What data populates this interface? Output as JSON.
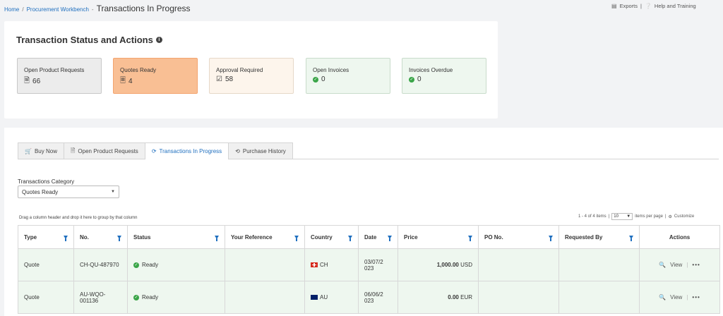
{
  "breadcrumb": {
    "home": "Home",
    "separator": "/",
    "workbench": "Procurement Workbench",
    "dash": "-",
    "current": "Transactions In Progress"
  },
  "top_links": {
    "exports": "Exports",
    "divider": "|",
    "help": "Help and Training"
  },
  "status_panel": {
    "title": "Transaction Status and Actions",
    "tiles": [
      {
        "label": "Open Product Requests",
        "value": "66",
        "icon": "document-icon"
      },
      {
        "label": "Quotes Ready",
        "value": "4",
        "icon": "document-icon"
      },
      {
        "label": "Approval Required",
        "value": "58",
        "icon": "checklist-icon"
      },
      {
        "label": "Open Invoices",
        "value": "0",
        "icon": "check-circle-icon"
      },
      {
        "label": "Invoices Overdue",
        "value": "0",
        "icon": "check-circle-icon"
      }
    ]
  },
  "tabs": [
    {
      "label": "Buy Now",
      "icon": "cart-icon",
      "active": false
    },
    {
      "label": "Open Product Requests",
      "icon": "document-icon",
      "active": false
    },
    {
      "label": "Transactions In Progress",
      "icon": "refresh-icon",
      "active": true
    },
    {
      "label": "Purchase History",
      "icon": "history-icon",
      "active": false
    }
  ],
  "category": {
    "label": "Transactions Category",
    "selected": "Quotes Ready"
  },
  "grid": {
    "drag_hint": "Drag a column header and drop it here to group by that column",
    "pager": {
      "items_text": "1 - 4 of 4 items",
      "divider": "|",
      "page_size": "10",
      "per_page_text": "items per page",
      "customize": "Customize"
    },
    "columns": [
      "Type",
      "No.",
      "Status",
      "Your Reference",
      "Country",
      "Date",
      "Price",
      "PO No.",
      "Requested By",
      "Actions"
    ],
    "rows": [
      {
        "type": "Quote",
        "no": "CH-QU-487970",
        "status": "Ready",
        "reference": "",
        "country": "CH",
        "date": "03/07/2023",
        "date_line1": "03/07/2",
        "date_line2": "023",
        "price": "1,000.00",
        "currency": "USD",
        "po": "",
        "requested_by": "",
        "action": "View"
      },
      {
        "type": "Quote",
        "no": "AU-WQO-001136",
        "no_line1": "AU-WQO-",
        "no_line2": "001136",
        "status": "Ready",
        "reference": "",
        "country": "AU",
        "date": "06/06/2023",
        "date_line1": "06/06/2",
        "date_line2": "023",
        "price": "0.00",
        "currency": "EUR",
        "po": "",
        "requested_by": "",
        "action": "View"
      }
    ]
  },
  "colors": {
    "link": "#1f6fbf",
    "quotes_ready": "#f9bf94",
    "approval": "#fdf5ec",
    "invoice": "#eef7ef",
    "ready_green": "#3aa548"
  }
}
